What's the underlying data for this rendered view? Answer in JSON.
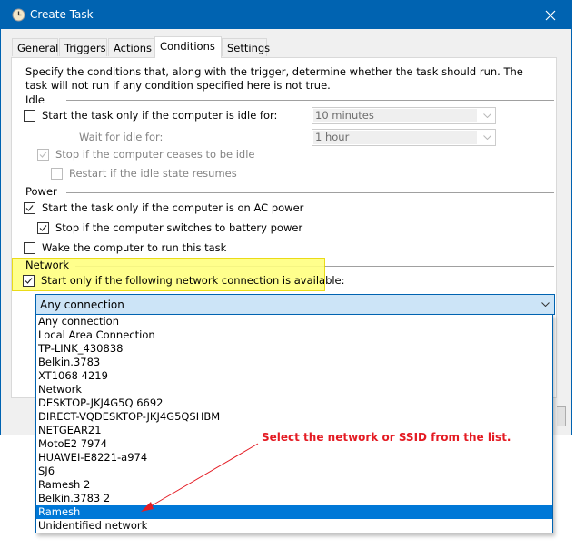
{
  "window": {
    "title": "Create Task",
    "icon": "clock-icon",
    "close_icon": "close-icon"
  },
  "tabs": [
    {
      "label": "General",
      "active": false
    },
    {
      "label": "Triggers",
      "active": false
    },
    {
      "label": "Actions",
      "active": false
    },
    {
      "label": "Conditions",
      "active": true
    },
    {
      "label": "Settings",
      "active": false
    }
  ],
  "conditions": {
    "intro": "Specify the conditions that, along with the trigger, determine whether the task should run.  The task will not run  if any condition specified here is not true.",
    "idle": {
      "label": "Idle",
      "start_if_idle": {
        "label": "Start the task only if the computer is idle for:",
        "checked": false,
        "enabled": true
      },
      "idle_duration": {
        "value": "10 minutes",
        "enabled": false
      },
      "wait_for_idle_label": "Wait for idle for:",
      "wait_duration": {
        "value": "1 hour",
        "enabled": false
      },
      "stop_if_ceases": {
        "label": "Stop if the computer ceases to be idle",
        "checked": true,
        "enabled": false
      },
      "restart_if_resumes": {
        "label": "Restart if the idle state resumes",
        "checked": false,
        "enabled": false
      }
    },
    "power": {
      "label": "Power",
      "ac_power": {
        "label": "Start the task only if the computer is on AC power",
        "checked": true
      },
      "battery_stop": {
        "label": "Stop if the computer switches to battery power",
        "checked": true
      },
      "wake": {
        "label": "Wake the computer to run this task",
        "checked": false
      }
    },
    "network": {
      "label": "Network",
      "start_only_if": {
        "label": "Start only if the following network connection is available:",
        "checked": true
      },
      "selected_connection": "Any connection",
      "options": [
        "Any connection",
        "Local Area Connection",
        "TP-LINK_430838",
        "Belkin.3783",
        "XT1068 4219",
        "Network",
        "DESKTOP-JKJ4G5Q 6692",
        "DIRECT-VQDESKTOP-JKJ4G5QSHBM",
        "NETGEAR21",
        "MotoE2 7974",
        "HUAWEI-E8221-a974",
        "SJ6",
        "Ramesh 2",
        "Belkin.3783  2",
        "Ramesh",
        "Unidentified network"
      ],
      "highlighted_option": "Ramesh"
    }
  },
  "annotation": {
    "text": "Select the network or SSID from the list.",
    "color": "#e41b23"
  },
  "colors": {
    "titlebar": "#0063b1",
    "selection": "#0078d7",
    "highlight": "#ffff80"
  }
}
